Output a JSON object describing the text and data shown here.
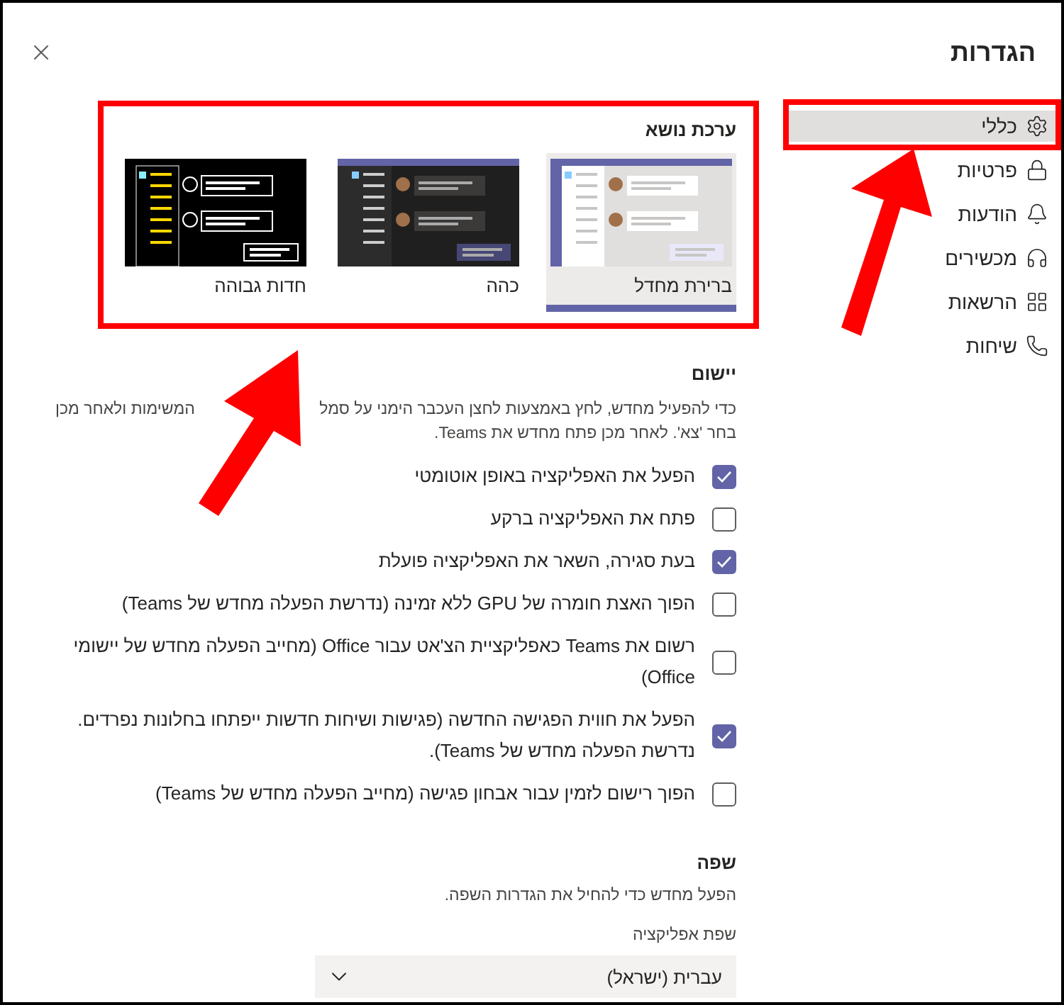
{
  "window": {
    "title": "הגדרות"
  },
  "sidebar": {
    "items": [
      {
        "label": "כללי",
        "kind": "gear",
        "selected": true
      },
      {
        "label": "פרטיות",
        "kind": "lock",
        "selected": false
      },
      {
        "label": "הודעות",
        "kind": "bell",
        "selected": false
      },
      {
        "label": "מכשירים",
        "kind": "headset",
        "selected": false
      },
      {
        "label": "הרשאות",
        "kind": "apps",
        "selected": false
      },
      {
        "label": "שיחות",
        "kind": "phone",
        "selected": false
      }
    ]
  },
  "theme": {
    "heading": "ערכת נושא",
    "options": [
      {
        "label": "ברירת מחדל",
        "kind": "light",
        "selected": true
      },
      {
        "label": "כהה",
        "kind": "dark",
        "selected": false
      },
      {
        "label": "חדות גבוהה",
        "kind": "contrast",
        "selected": false
      }
    ]
  },
  "application": {
    "heading": "יישום",
    "description_parts": [
      "כדי להפעיל מחדש, לחץ באמצעות לחצן העכבר הימני על סמל",
      "המשימות ולאחר מכן",
      "בחר 'צא'. לאחר מכן פתח מחדש את Teams."
    ],
    "options": [
      {
        "label": "הפעל את האפליקציה באופן אוטומטי",
        "checked": true
      },
      {
        "label": "פתח את האפליקציה ברקע",
        "checked": false
      },
      {
        "label": "בעת סגירה, השאר את האפליקציה פועלת",
        "checked": true
      },
      {
        "label": "הפוך האצת חומרה של GPU ללא זמינה (נדרשת הפעלה מחדש של Teams)",
        "checked": false
      },
      {
        "label": "רשום את Teams כאפליקציית הצ'אט עבור Office (מחייב הפעלה מחדש של יישומי Office)",
        "checked": false
      },
      {
        "label": "הפעל את חווית הפגישה החדשה (פגישות ושיחות חדשות ייפתחו בחלונות נפרדים. נדרשת הפעלה מחדש של Teams).",
        "checked": true
      },
      {
        "label": "הפוך רישום לזמין עבור אבחון פגישה (מחייב הפעלה מחדש של Teams)",
        "checked": false
      }
    ]
  },
  "language": {
    "heading": "שפה",
    "description": "הפעל מחדש כדי להחיל את הגדרות השפה.",
    "field_label": "שפת אפליקציה",
    "value": "עברית (ישראל)"
  }
}
